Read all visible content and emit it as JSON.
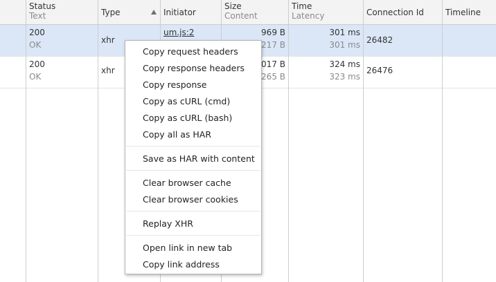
{
  "columns": {
    "status": {
      "main": "Status",
      "sub": "Text"
    },
    "type": {
      "main": "Type"
    },
    "initiator": {
      "main": "Initiator"
    },
    "size": {
      "main": "Size",
      "sub": "Content"
    },
    "time": {
      "main": "Time",
      "sub": "Latency"
    },
    "connection": {
      "main": "Connection Id"
    },
    "timeline": {
      "main": "Timeline"
    }
  },
  "sort": {
    "column": "Type",
    "direction": "ascending",
    "icon": "sort-ascending-icon"
  },
  "rows": [
    {
      "status": "200",
      "status_text": "OK",
      "type": "xhr",
      "initiator": "um.js:2",
      "size": "969 B",
      "content": "217 B",
      "time": "301 ms",
      "latency": "301 ms",
      "connection_id": "26482",
      "selected": true
    },
    {
      "status": "200",
      "status_text": "OK",
      "type": "xhr",
      "initiator": "",
      "size": "1017 B",
      "content": "265 B",
      "time": "324 ms",
      "latency": "323 ms",
      "connection_id": "26476",
      "selected": false
    }
  ],
  "context_menu": {
    "items": [
      "Copy request headers",
      "Copy response headers",
      "Copy response",
      "Copy as cURL (cmd)",
      "Copy as cURL (bash)",
      "Copy all as HAR",
      "Save as HAR with content",
      "Clear browser cache",
      "Clear browser cookies",
      "Replay XHR",
      "Open link in new tab",
      "Copy link address"
    ]
  },
  "colors": {
    "header_bg": "#f3f3f3",
    "selected_row_bg": "#dbe7f7",
    "grid_line": "#cdcdcd",
    "menu_bg": "#ffffff",
    "menu_border": "#b5b5b5"
  }
}
